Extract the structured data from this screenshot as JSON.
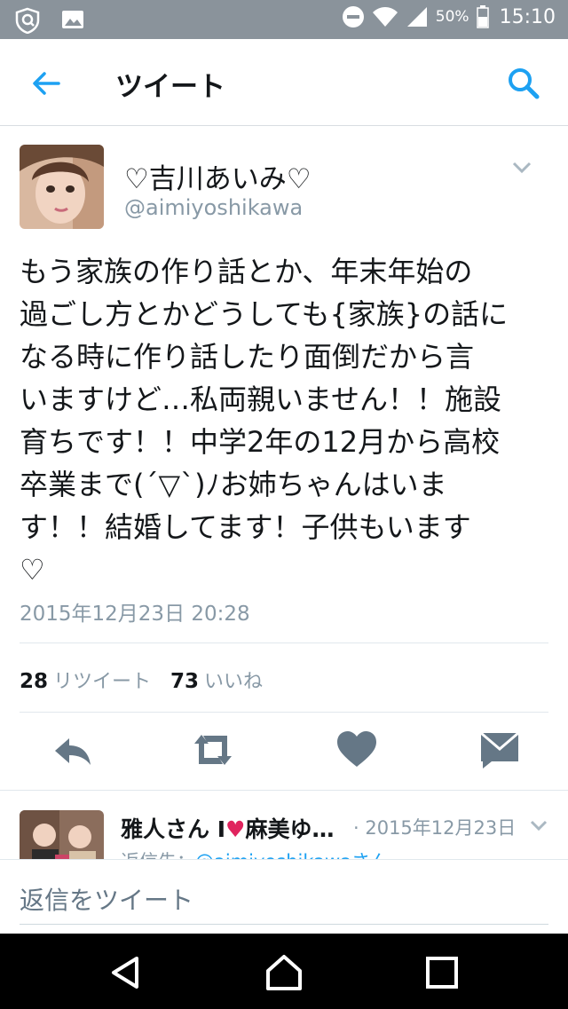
{
  "status_bar": {
    "battery": "50%",
    "time": "15:10"
  },
  "header": {
    "title": "ツイート"
  },
  "tweet": {
    "display_name": "♡吉川あいみ♡",
    "handle": "@aimiyoshikawa",
    "text": "もう家族の作り話とか、年末年始の\n過ごし方とかどうしても{家族}の話に\nなる時に作り話したり面倒だから言\nいますけど…私両親いません！！施設\n育ちです！！中学2年の12月から高校\n卒業まで(´▽`)ﾉお姉ちゃんはいま\nす！！結婚してます！子供もいます\n♡",
    "timestamp": "2015年12月23日 20:28",
    "retweet_count": "28",
    "retweet_label": "リツイート",
    "like_count": "73",
    "like_label": "いいね"
  },
  "reply": {
    "name_part1": "雅人さん I",
    "heart": "♥",
    "name_part2": "麻美ゆ…",
    "date": "· 2015年12月23日",
    "reply_prefix": "返信先：",
    "reply_handle": "@aimiyoshikawaさん"
  },
  "compose": {
    "placeholder": "返信をツイート"
  },
  "colors": {
    "accent": "#1da1f2",
    "icon_gray": "#657786",
    "status_bar": "#8a939b"
  }
}
